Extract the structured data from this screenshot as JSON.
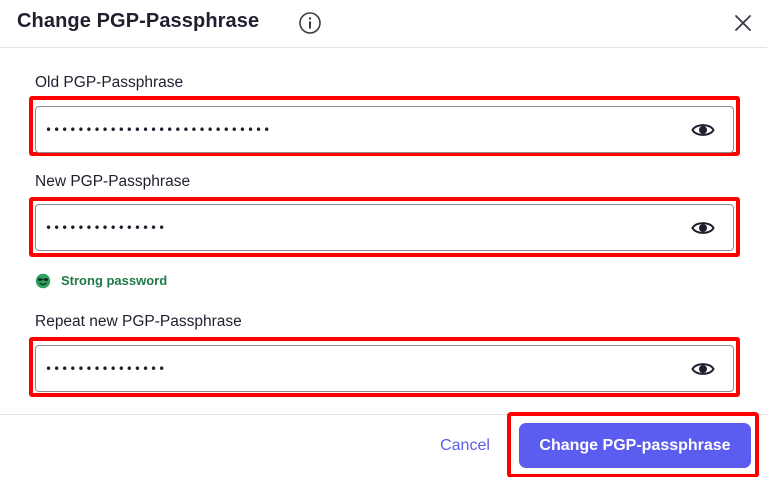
{
  "dialog": {
    "title": "Change PGP-Passphrase",
    "info_icon": "info-icon",
    "close_icon": "close-icon"
  },
  "fields": {
    "old": {
      "label": "Old PGP-Passphrase",
      "value": "••••••••••••••••••••••••••••"
    },
    "new": {
      "label": "New PGP-Passphrase",
      "value": "•••••••••••••••"
    },
    "repeat": {
      "label": "Repeat new PGP-Passphrase",
      "value": "•••••••••••••••"
    }
  },
  "strength": {
    "text": "Strong password",
    "icon": "strong-face-icon",
    "color": "#1f7a4a"
  },
  "footer": {
    "cancel_label": "Cancel",
    "submit_label": "Change PGP-passphrase"
  },
  "colors": {
    "accent": "#5b5cf0",
    "highlight": "#ff0000",
    "link": "#5b5fe6"
  }
}
